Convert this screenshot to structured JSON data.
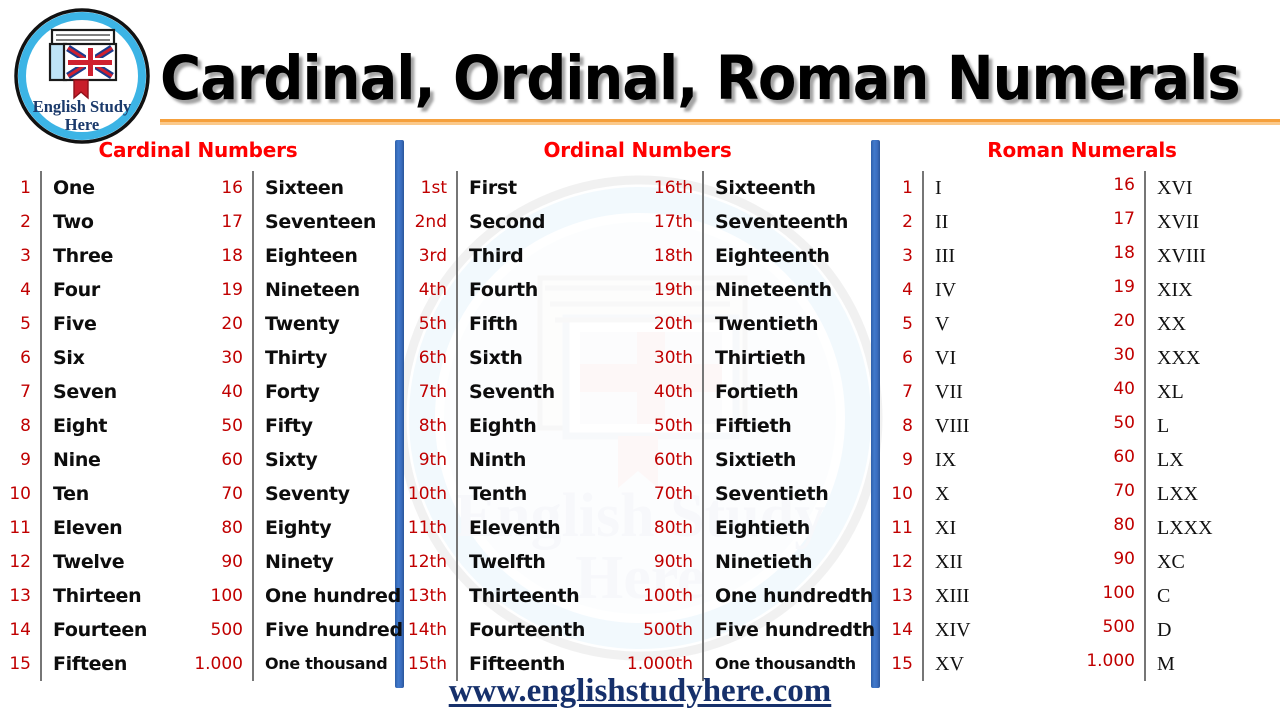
{
  "header": {
    "title": "Cardinal, Ordinal, Roman Numerals",
    "logo": {
      "line1": "English Study",
      "line2": "Here",
      "icon": "book-uk-flag-badge"
    },
    "rule_color": "#F5A03C"
  },
  "colors": {
    "header_red": "#FF0000",
    "number_red": "#C00000",
    "word_black": "#0D0D0D",
    "divider_blue": "#3A6DBE",
    "divider_gray": "#767676",
    "footer_navy": "#16306B",
    "rule_orange": "#F5A03C"
  },
  "sections": [
    {
      "id": "cardinal",
      "title": "Cardinal Numbers",
      "left": {
        "numbers": [
          "1",
          "2",
          "3",
          "4",
          "5",
          "6",
          "7",
          "8",
          "9",
          "10",
          "11",
          "12",
          "13",
          "14",
          "15"
        ],
        "words": [
          "One",
          "Two",
          "Three",
          "Four",
          "Five",
          "Six",
          "Seven",
          "Eight",
          "Nine",
          "Ten",
          "Eleven",
          "Twelve",
          "Thirteen",
          "Fourteen",
          "Fifteen"
        ]
      },
      "right": {
        "numbers": [
          "16",
          "17",
          "18",
          "19",
          "20",
          "30",
          "40",
          "50",
          "60",
          "70",
          "80",
          "90",
          "100",
          "500",
          "1.000"
        ],
        "words": [
          "Sixteen",
          "Seventeen",
          "Eighteen",
          "Nineteen",
          "Twenty",
          "Thirty",
          "Forty",
          "Fifty",
          "Sixty",
          "Seventy",
          "Eighty",
          "Ninety",
          "One hundred",
          "Five hundred",
          "One thousand"
        ]
      }
    },
    {
      "id": "ordinal",
      "title": "Ordinal Numbers",
      "left": {
        "numbers": [
          "1st",
          "2nd",
          "3rd",
          "4th",
          "5th",
          "6th",
          "7th",
          "8th",
          "9th",
          "10th",
          "11th",
          "12th",
          "13th",
          "14th",
          "15th"
        ],
        "words": [
          "First",
          "Second",
          "Third",
          "Fourth",
          "Fifth",
          "Sixth",
          "Seventh",
          "Eighth",
          "Ninth",
          "Tenth",
          "Eleventh",
          "Twelfth",
          "Thirteenth",
          "Fourteenth",
          "Fifteenth"
        ]
      },
      "right": {
        "numbers": [
          "16th",
          "17th",
          "18th",
          "19th",
          "20th",
          "30th",
          "40th",
          "50th",
          "60th",
          "70th",
          "80th",
          "90th",
          "100th",
          "500th",
          "1.000th"
        ],
        "words": [
          "Sixteenth",
          "Seventeenth",
          "Eighteenth",
          "Nineteenth",
          "Twentieth",
          "Thirtieth",
          "Fortieth",
          "Fiftieth",
          "Sixtieth",
          "Seventieth",
          "Eightieth",
          "Ninetieth",
          "One hundredth",
          "Five hundredth",
          "One thousandth"
        ]
      }
    },
    {
      "id": "roman",
      "title": "Roman Numerals",
      "left": {
        "numbers": [
          "1",
          "2",
          "3",
          "4",
          "5",
          "6",
          "7",
          "8",
          "9",
          "10",
          "11",
          "12",
          "13",
          "14",
          "15"
        ],
        "words": [
          "I",
          "II",
          "III",
          "IV",
          "V",
          "VI",
          "VII",
          "VIII",
          "IX",
          "X",
          "XI",
          "XII",
          "XIII",
          "XIV",
          "XV"
        ]
      },
      "right": {
        "numbers": [
          "16",
          "17",
          "18",
          "19",
          "20",
          "30",
          "40",
          "50",
          "60",
          "70",
          "80",
          "90",
          "100",
          "500",
          "1.000"
        ],
        "words": [
          "XVI",
          "XVII",
          "XVIII",
          "XIX",
          "XX",
          "XXX",
          "XL",
          "L",
          "LX",
          "LXX",
          "LXXX",
          "XC",
          "C",
          "D",
          "M"
        ]
      }
    }
  ],
  "footer": {
    "url": "www.englishstudyhere.com"
  }
}
